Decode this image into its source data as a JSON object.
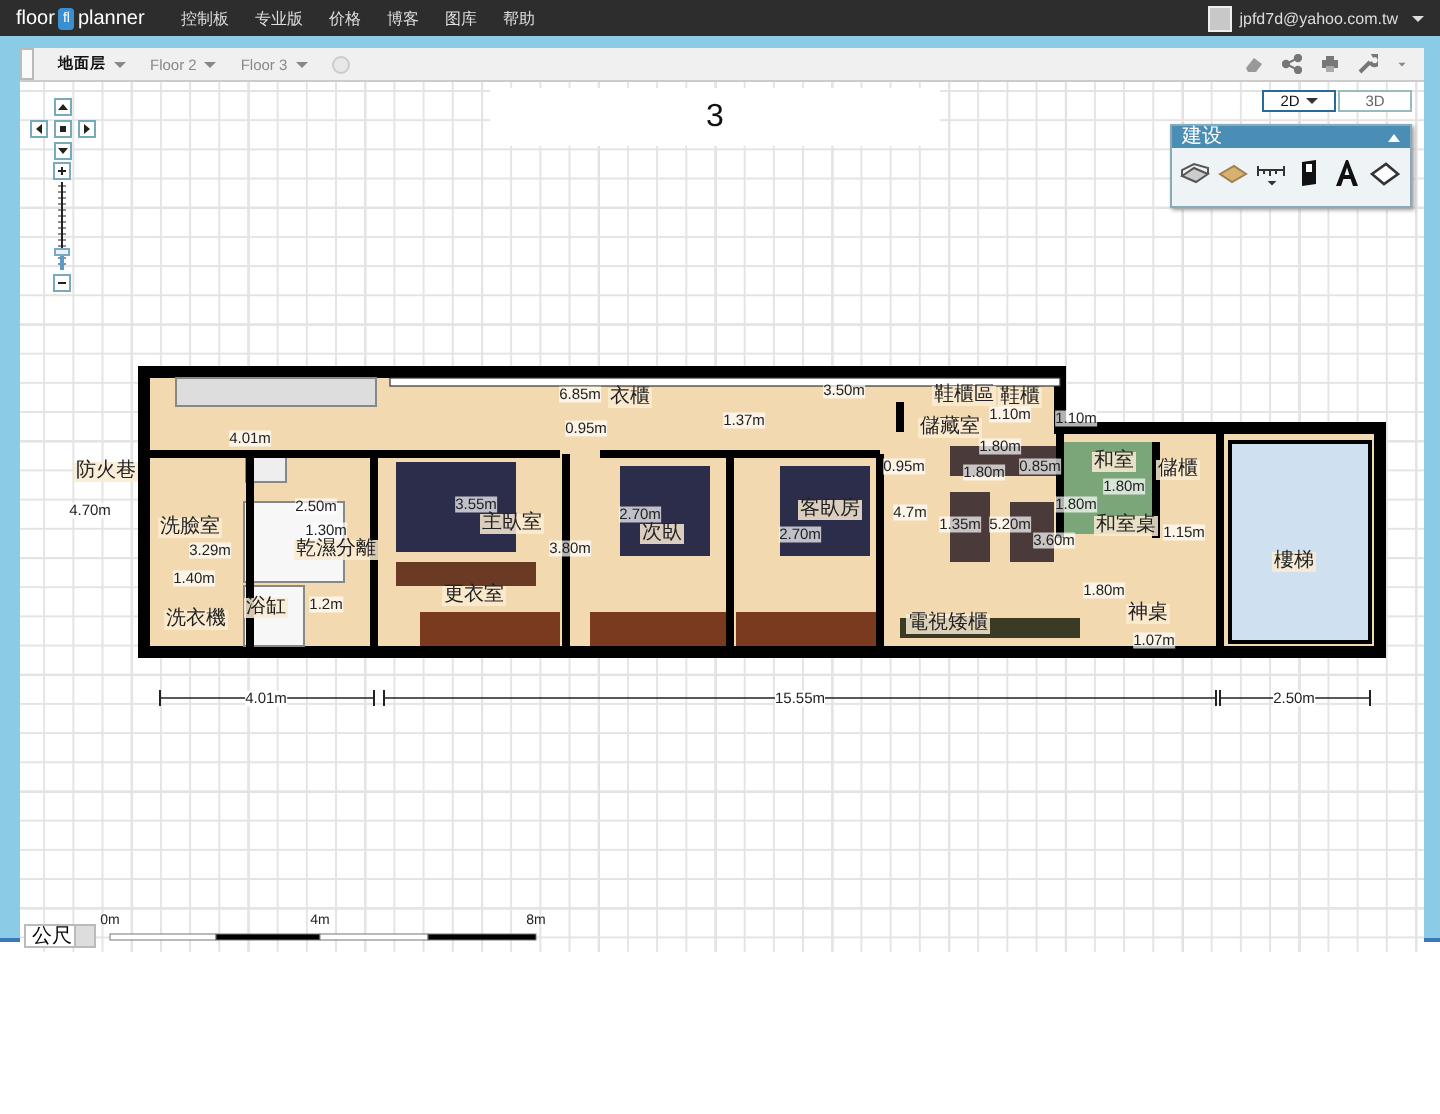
{
  "top_bar": {
    "logo": {
      "left": "floor",
      "mark": "fl",
      "right": "planner"
    },
    "menu": [
      "控制板",
      "专业版",
      "价格",
      "博客",
      "图库",
      "帮助"
    ],
    "user_email": "jpfd7d@yahoo.com.tw"
  },
  "floor_tabs": [
    {
      "label": "地面层",
      "selected": true
    },
    {
      "label": "Floor 2",
      "selected": false
    },
    {
      "label": "Floor 3",
      "selected": false
    }
  ],
  "plan_title": "3",
  "view_buttons": [
    {
      "label": "2D",
      "selected": true
    },
    {
      "label": "3D",
      "selected": false
    }
  ],
  "build_panel": {
    "title": "建设",
    "tools": [
      {
        "kind": "wall"
      },
      {
        "kind": "floor"
      },
      {
        "kind": "measure"
      },
      {
        "kind": "door"
      },
      {
        "kind": "text"
      },
      {
        "kind": "surface"
      }
    ]
  },
  "zoom": {
    "level": 0.2
  },
  "plan": {
    "labels": [
      {
        "text": "防火巷",
        "kind": "room"
      },
      {
        "text": "4.70m",
        "kind": "dim"
      },
      {
        "text": "4.01m",
        "kind": "dim"
      },
      {
        "text": "6.85m",
        "kind": "dim"
      },
      {
        "text": "衣櫃",
        "kind": "room"
      },
      {
        "text": "0.95m",
        "kind": "dim"
      },
      {
        "text": "1.37m",
        "kind": "dim"
      },
      {
        "text": "3.50m",
        "kind": "dim"
      },
      {
        "text": "鞋櫃區",
        "kind": "room"
      },
      {
        "text": "鞋櫃",
        "kind": "room"
      },
      {
        "text": "1.10m",
        "kind": "dim"
      },
      {
        "text": "儲藏室",
        "kind": "room"
      },
      {
        "text": "1.10m",
        "kind": "dim"
      },
      {
        "text": "1.80m",
        "kind": "dim"
      },
      {
        "text": "洗臉室",
        "kind": "room"
      },
      {
        "text": "3.29m",
        "kind": "dim"
      },
      {
        "text": "1.40m",
        "kind": "dim"
      },
      {
        "text": "洗衣機",
        "kind": "room"
      },
      {
        "text": "2.50m",
        "kind": "dim"
      },
      {
        "text": "1.30m",
        "kind": "dim"
      },
      {
        "text": "乾濕分離",
        "kind": "room"
      },
      {
        "text": "浴缸",
        "kind": "room"
      },
      {
        "text": "1.2m",
        "kind": "dim"
      },
      {
        "text": "3.55m",
        "kind": "dim"
      },
      {
        "text": "主臥室",
        "kind": "room"
      },
      {
        "text": "3.80m",
        "kind": "dim"
      },
      {
        "text": "更衣室",
        "kind": "room"
      },
      {
        "text": "2.70m",
        "kind": "dim"
      },
      {
        "text": "次臥",
        "kind": "room"
      },
      {
        "text": "2.70m",
        "kind": "dim"
      },
      {
        "text": "客臥房",
        "kind": "room"
      },
      {
        "text": "0.95m",
        "kind": "dim"
      },
      {
        "text": "4.7m",
        "kind": "dim"
      },
      {
        "text": "1.80m",
        "kind": "dim"
      },
      {
        "text": "0.85m",
        "kind": "dim"
      },
      {
        "text": "和室",
        "kind": "room"
      },
      {
        "text": "1.80m",
        "kind": "dim"
      },
      {
        "text": "儲櫃",
        "kind": "room"
      },
      {
        "text": "1.80m",
        "kind": "dim"
      },
      {
        "text": "和室桌",
        "kind": "room"
      },
      {
        "text": "1.15m",
        "kind": "dim"
      },
      {
        "text": "1.35m",
        "kind": "dim"
      },
      {
        "text": "5.20m",
        "kind": "dim"
      },
      {
        "text": "3.60m",
        "kind": "dim"
      },
      {
        "text": "1.80m",
        "kind": "dim"
      },
      {
        "text": "樓梯",
        "kind": "room"
      },
      {
        "text": "電視矮櫃",
        "kind": "room"
      },
      {
        "text": "神桌",
        "kind": "room"
      },
      {
        "text": "1.07m",
        "kind": "dim"
      }
    ],
    "overall_dimensions": [
      "4.01m",
      "15.55m",
      "2.50m"
    ]
  },
  "scale": {
    "unit": "公尺",
    "ticks": [
      "0m",
      "4m",
      "8m"
    ]
  }
}
